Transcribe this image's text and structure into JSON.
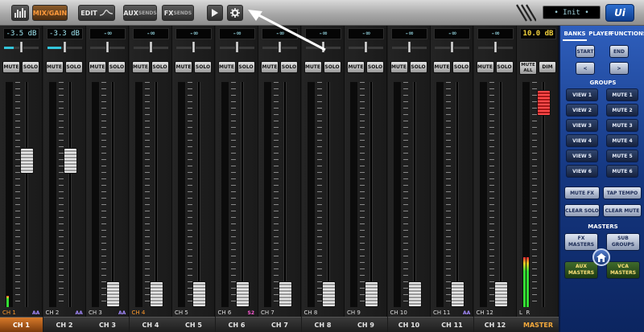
{
  "toolbar": {
    "mix_gain_label": "MIX/GAIN",
    "edit_label": "EDIT",
    "aux_label_a": "AUX",
    "aux_label_b": "SENDS",
    "fx_label_a": "FX",
    "fx_label_b": "SENDS",
    "status_text": "• Init •",
    "logo_text": "Ui"
  },
  "channels": [
    {
      "name": "CH 1",
      "gain": "-3.5 dB",
      "source": "CH 1",
      "source_color": "orange",
      "pan_fill": 0.28,
      "fader_level": 0.67,
      "meter_l": 0.05,
      "meter_r": 0.0,
      "tag": "AA",
      "tag_color": "#a58bff",
      "selected": true
    },
    {
      "name": "CH 2",
      "gain": "-3.3 dB",
      "source": "CH 2",
      "source_color": "white",
      "pan_fill": 0.4,
      "fader_level": 0.67,
      "meter_l": 0.0,
      "meter_r": 0.0,
      "tag": "AA",
      "tag_color": "#a58bff",
      "selected": false
    },
    {
      "name": "CH 3",
      "gain": "-∞",
      "source": "CH 3",
      "source_color": "white",
      "pan_fill": 0.0,
      "fader_level": 0.0,
      "meter_l": 0.0,
      "meter_r": 0.0,
      "tag": "AA",
      "tag_color": "#a58bff",
      "selected": false
    },
    {
      "name": "CH 4",
      "gain": "-∞",
      "source": "CH 4",
      "source_color": "orange",
      "pan_fill": 0.0,
      "fader_level": 0.0,
      "meter_l": 0.0,
      "meter_r": 0.0,
      "tag": "",
      "tag_color": "#a58bff",
      "selected": false
    },
    {
      "name": "CH 5",
      "gain": "-∞",
      "source": "CH 5",
      "source_color": "white",
      "pan_fill": 0.0,
      "fader_level": 0.0,
      "meter_l": 0.0,
      "meter_r": 0.0,
      "tag": "",
      "tag_color": "#a58bff",
      "selected": false
    },
    {
      "name": "CH 6",
      "gain": "-∞",
      "source": "CH 6",
      "source_color": "white",
      "pan_fill": 0.0,
      "fader_level": 0.0,
      "meter_l": 0.0,
      "meter_r": 0.0,
      "tag": "S2",
      "tag_color": "#ff5ad6",
      "selected": false
    },
    {
      "name": "CH 7",
      "gain": "-∞",
      "source": "CH 7",
      "source_color": "white",
      "pan_fill": 0.0,
      "fader_level": 0.0,
      "meter_l": 0.0,
      "meter_r": 0.0,
      "tag": "",
      "tag_color": "#a58bff",
      "selected": false
    },
    {
      "name": "CH 8",
      "gain": "-∞",
      "source": "CH 8",
      "source_color": "white",
      "pan_fill": 0.0,
      "fader_level": 0.0,
      "meter_l": 0.0,
      "meter_r": 0.0,
      "tag": "",
      "tag_color": "#a58bff",
      "selected": false
    },
    {
      "name": "CH 9",
      "gain": "-∞",
      "source": "CH 9",
      "source_color": "white",
      "pan_fill": 0.0,
      "fader_level": 0.0,
      "meter_l": 0.0,
      "meter_r": 0.0,
      "tag": "",
      "tag_color": "#a58bff",
      "selected": false
    },
    {
      "name": "CH 10",
      "gain": "-∞",
      "source": "CH 10",
      "source_color": "white",
      "pan_fill": 0.0,
      "fader_level": 0.0,
      "meter_l": 0.0,
      "meter_r": 0.0,
      "tag": "",
      "tag_color": "#a58bff",
      "selected": false
    },
    {
      "name": "CH 11",
      "gain": "-∞",
      "source": "CH 11",
      "source_color": "white",
      "pan_fill": 0.0,
      "fader_level": 0.0,
      "meter_l": 0.0,
      "meter_r": 0.0,
      "tag": "AA",
      "tag_color": "#a58bff",
      "selected": false
    },
    {
      "name": "CH 12",
      "gain": "-∞",
      "source": "CH 12",
      "source_color": "white",
      "pan_fill": 0.0,
      "fader_level": 0.0,
      "meter_l": 0.0,
      "meter_r": 0.0,
      "tag": "",
      "tag_color": "#a58bff",
      "selected": false
    }
  ],
  "master": {
    "name": "MASTER",
    "gain": "10.0 dB",
    "mute_all_a": "MUTE",
    "mute_all_b": "ALL",
    "dim_label": "DIM",
    "lr_label": "L  R",
    "fader_level": 0.96,
    "meter_l": 0.22,
    "meter_r": 0.22
  },
  "strip_buttons": {
    "mute": "MUTE",
    "solo": "SOLO"
  },
  "panel": {
    "tabs": [
      "BANKS",
      "PLAYER",
      "FUNCTIONS"
    ],
    "start_label": "START",
    "end_label": "END",
    "prev_label": "<",
    "next_label": ">",
    "groups_title": "GROUPS",
    "views": [
      "VIEW 1",
      "VIEW 2",
      "VIEW 3",
      "VIEW 4",
      "VIEW 5",
      "VIEW 6"
    ],
    "mutes": [
      "MUTE 1",
      "MUTE 2",
      "MUTE 3",
      "MUTE 4",
      "MUTE 5",
      "MUTE 6"
    ],
    "mute_fx": "MUTE FX",
    "tap_tempo": "TAP TEMPO",
    "clear_solo": "CLEAR SOLO",
    "clear_mute": "CLEAR MUTE",
    "masters_title": "MASTERS",
    "fx_masters_a": "FX",
    "fx_masters_b": "MASTERS",
    "sub_groups_a": "SUB",
    "sub_groups_b": "GROUPS",
    "aux_masters_a": "AUX",
    "aux_masters_b": "MASTERS",
    "vca_masters_a": "VCA",
    "vca_masters_b": "MASTERS"
  },
  "icons": [
    "meters-icon",
    "eq-curve-icon",
    "play-icon",
    "gear-icon",
    "home-icon",
    "annotation-arrow-icon"
  ],
  "colors": {
    "accent": "#ff9a3c",
    "panel_blue": "#1f4a9e",
    "gain_text": "#9fe6f2",
    "master_gain": "#f3d23c"
  }
}
